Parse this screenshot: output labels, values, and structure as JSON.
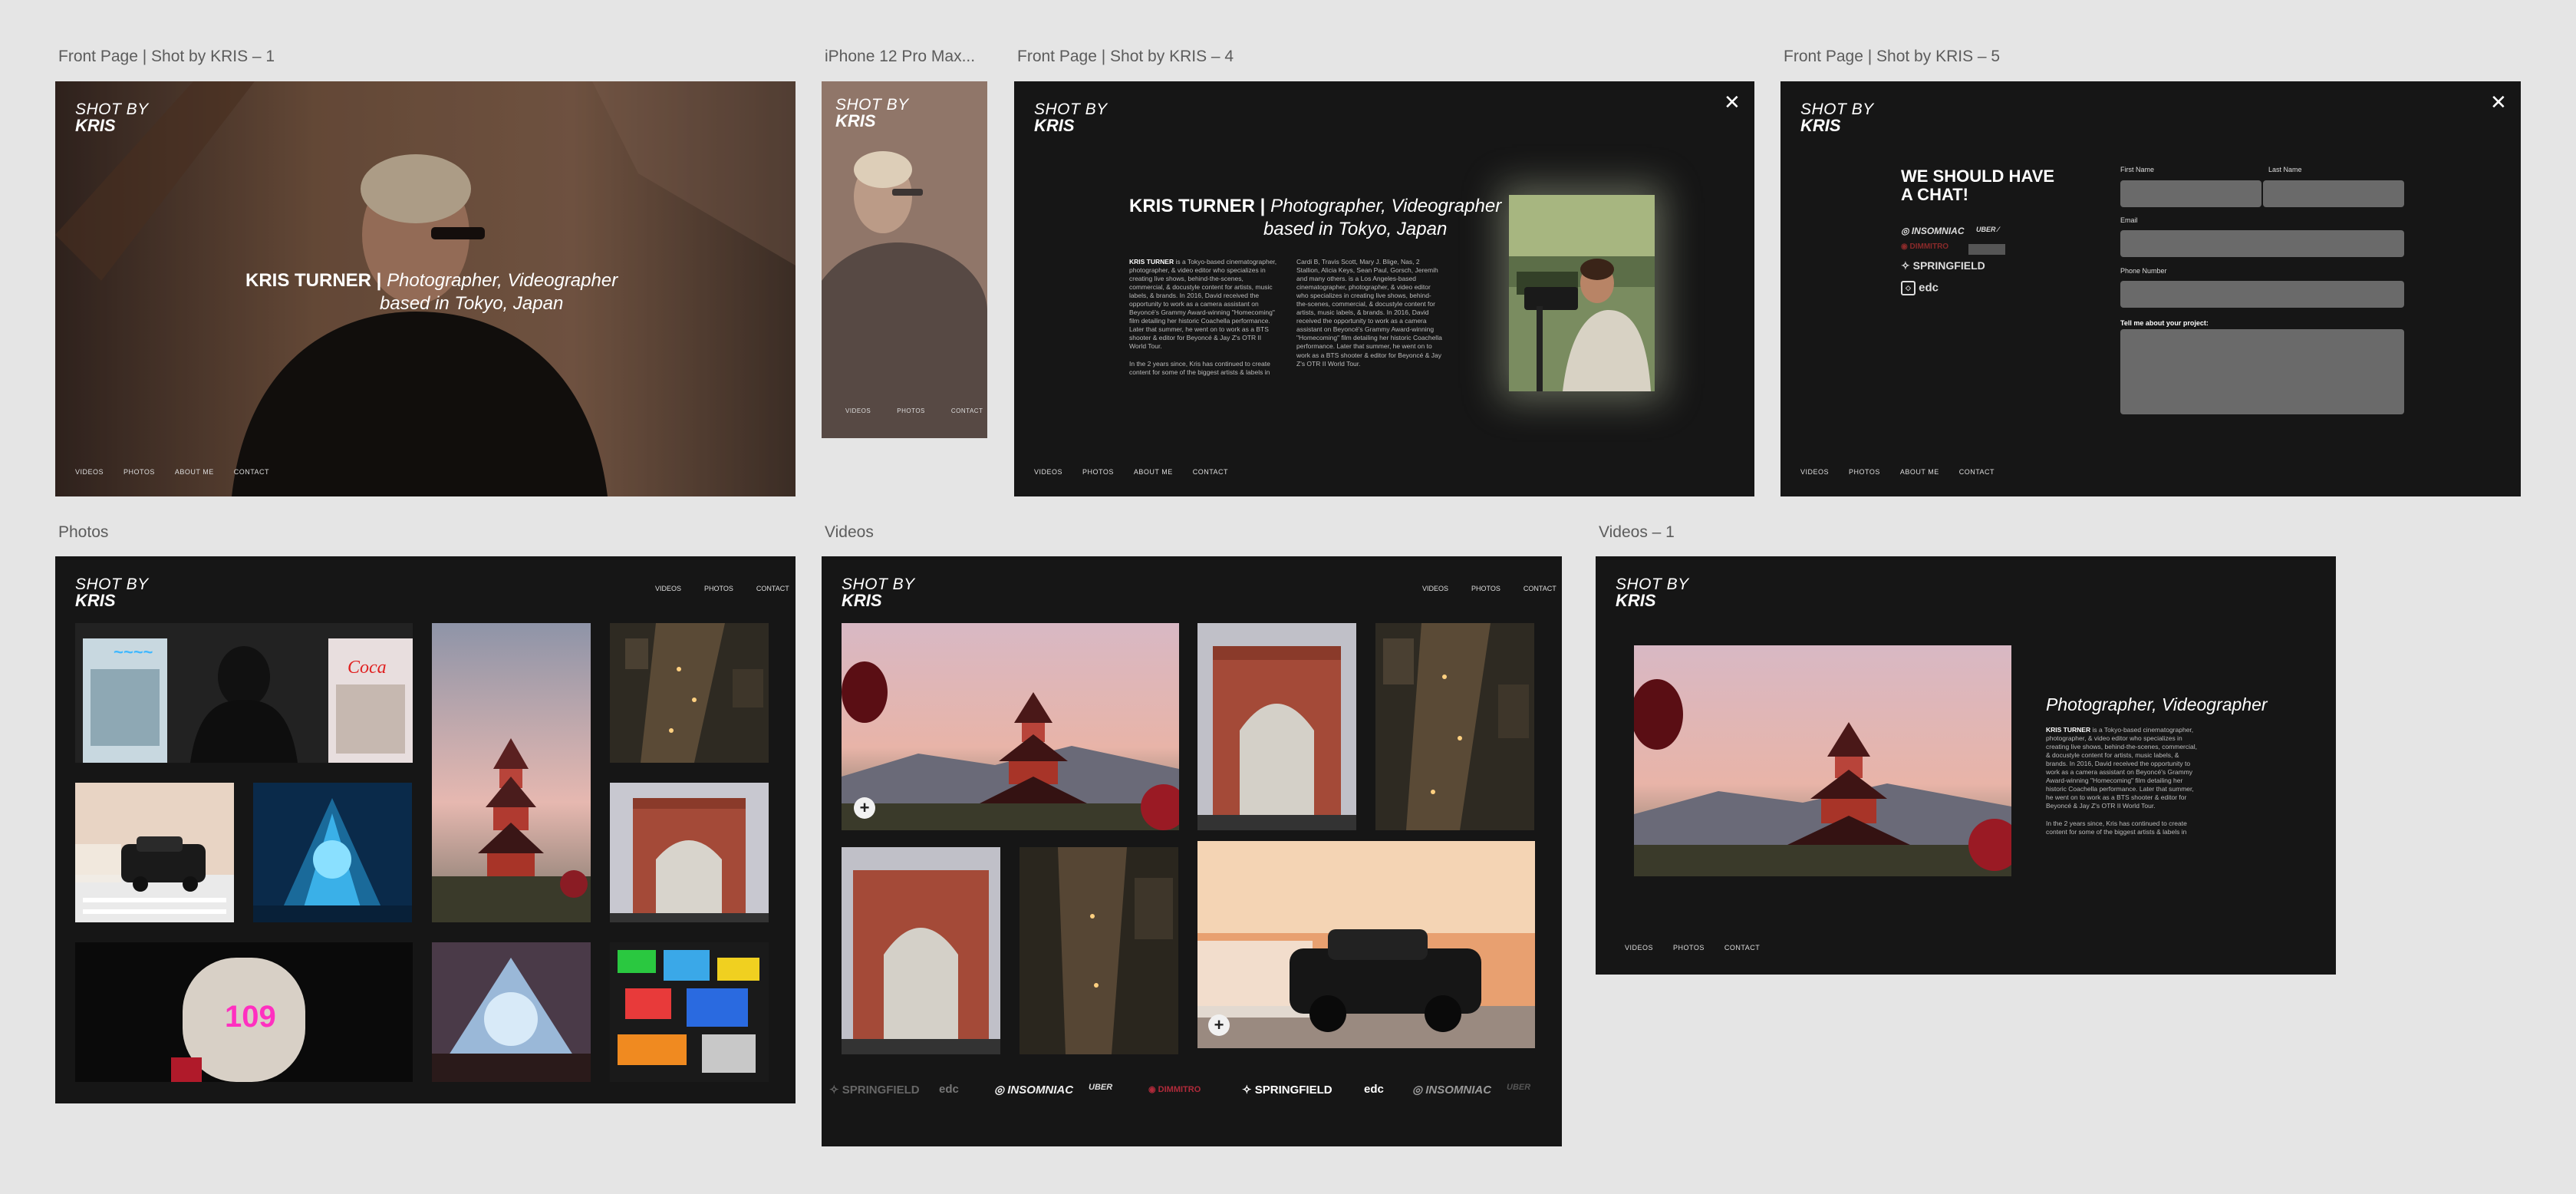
{
  "frames": {
    "fp1": "Front Page | Shot by KRIS – 1",
    "iphone": "iPhone 12 Pro Max...",
    "fp4": "Front Page | Shot by KRIS – 4",
    "fp5": "Front Page | Shot by KRIS – 5",
    "photos": "Photos",
    "videos": "Videos",
    "videos1": "Videos – 1"
  },
  "logo": {
    "line1": "SHOT BY",
    "line2": "KRIS"
  },
  "hero": {
    "name": "KRIS TURNER |",
    "line1": "Photographer, Videographer",
    "line2": "based in Tokyo, Japan"
  },
  "nav": {
    "videos": "VIDEOS",
    "photos": "PHOTOS",
    "about": "ABOUT ME",
    "contact": "CONTACT"
  },
  "bio": {
    "name": "KRIS TURNER",
    "p1": "is a Tokyo-based cinematographer, photographer, & video editor who specializes in creating live shows, behind-the-scenes, commercial, & docustyle content for artists, music labels, & brands. In 2016, David received the opportunity to work as a camera assistant on Beyoncé's Grammy Award-winning \"Homecoming\" film detailing her historic Coachella performance. Later that summer, he went on to work as a BTS shooter & editor for Beyoncé & Jay Z's OTR II World Tour.",
    "p2": "In the 2 years since, Kris has continued to create content for some of the biggest artists & labels in",
    "col2": "Cardi B, Travis Scott, Mary J. Blige, Nas, 2 Stallion, Alicia Keys, Sean Paul, Gorsch, Jeremih and many others. is a Los Angeles-based cinematographer, photographer, & video editor who specializes in creating live shows, behind-the-scenes, commercial, & docustyle content for artists, music labels, & brands. In 2016, David received the opportunity to work as a camera assistant on Beyoncé's Grammy Award-winning \"Homecoming\" film detailing her historic Coachella performance. Later that summer, he went on to work as a BTS shooter & editor for Beyoncé & Jay Z's OTR II World Tour."
  },
  "contact": {
    "heading_line1": "WE SHOULD HAVE",
    "heading_line2": "A CHAT!",
    "first_name": "First Name",
    "last_name": "Last Name",
    "email": "Email",
    "phone": "Phone Number",
    "project": "Tell me about your project:"
  },
  "brands": {
    "insomniac": "INSOMNIAC",
    "uber": "UBER",
    "springfield": "SPRINGFIELD",
    "edc": "edc",
    "redbrand": "DIMMITRO"
  },
  "videos1_title": "Photographer, Videographer",
  "icons": {
    "close": "close-icon",
    "add": "plus-icon"
  }
}
